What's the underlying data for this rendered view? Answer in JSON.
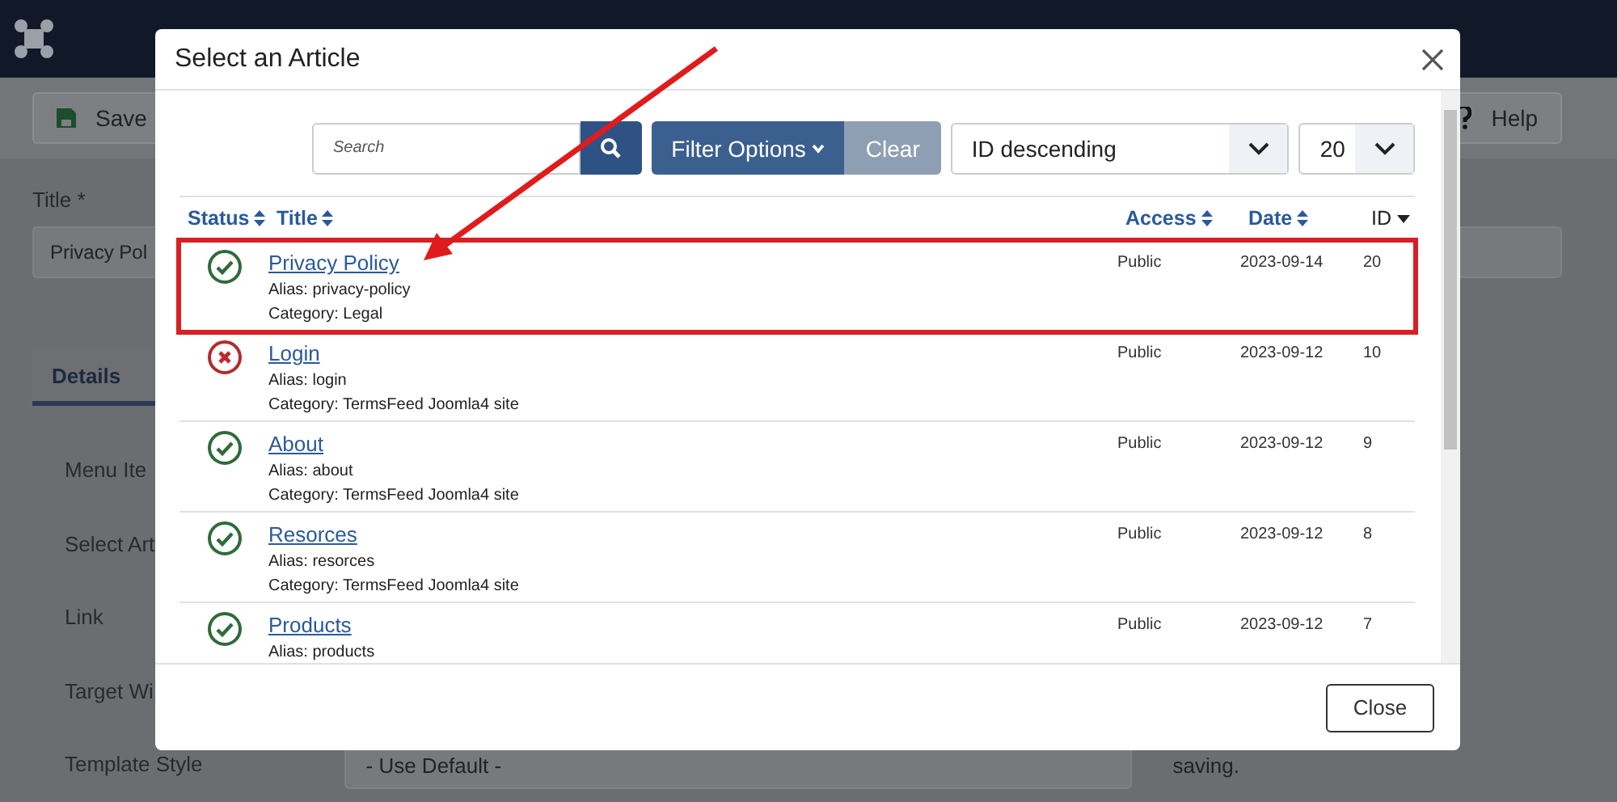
{
  "toolbar": {
    "buttons": [
      {
        "label": "Save",
        "kind": "save"
      },
      {
        "label": "Help",
        "kind": "help"
      }
    ]
  },
  "form": {
    "title_label": "Title *",
    "title_value": "Privacy Pol",
    "tab": "Details",
    "labels": [
      "Menu Ite",
      "Select Art",
      "Link",
      "Target Wi"
    ],
    "template_label": "Template Style",
    "template_value": "- Use Default -",
    "note": "saving."
  },
  "modal": {
    "title": "Select an Article",
    "search": {
      "placeholder": "Search"
    },
    "filter_button": "Filter Options",
    "clear_button": "Clear",
    "sort": "ID descending",
    "limit": "20",
    "columns": [
      {
        "label": "Status",
        "active": false
      },
      {
        "label": "Title",
        "active": false
      },
      {
        "label": "Access",
        "active": false
      },
      {
        "label": "Date",
        "active": false
      },
      {
        "label": "ID",
        "active": true
      }
    ],
    "rows": [
      {
        "published": true,
        "title": "Privacy Policy",
        "alias": "Alias: privacy-policy",
        "category": "Category: Legal",
        "access": "Public",
        "date": "2023-09-14",
        "id": "20",
        "highlighted": true
      },
      {
        "published": false,
        "title": "Login",
        "alias": "Alias: login",
        "category": "Category: TermsFeed Joomla4 site",
        "access": "Public",
        "date": "2023-09-12",
        "id": "10",
        "highlighted": false
      },
      {
        "published": true,
        "title": "About",
        "alias": "Alias: about",
        "category": "Category: TermsFeed Joomla4 site",
        "access": "Public",
        "date": "2023-09-12",
        "id": "9",
        "highlighted": false
      },
      {
        "published": true,
        "title": "Resorces",
        "alias": "Alias: resorces",
        "category": "Category: TermsFeed Joomla4 site",
        "access": "Public",
        "date": "2023-09-12",
        "id": "8",
        "highlighted": false
      },
      {
        "published": true,
        "title": "Products",
        "alias": "Alias: products",
        "access": "Public",
        "date": "2023-09-12",
        "id": "7",
        "highlighted": false
      }
    ],
    "close_button": "Close"
  }
}
